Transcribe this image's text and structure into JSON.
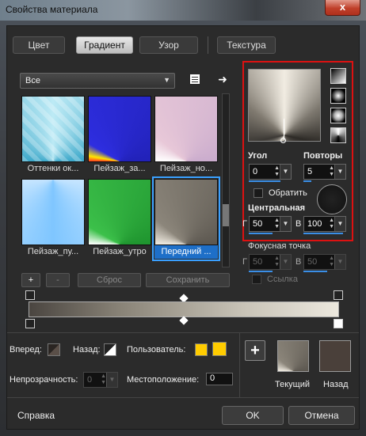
{
  "window": {
    "title": "Свойства материала",
    "close": "x"
  },
  "tabs": [
    {
      "label": "Цвет"
    },
    {
      "label": "Градиент"
    },
    {
      "label": "Узор"
    },
    {
      "label": "Текстура"
    }
  ],
  "filter": {
    "value": "Все"
  },
  "thumbnails": [
    {
      "label": "Оттенки ок..."
    },
    {
      "label": "Пейзаж_за..."
    },
    {
      "label": "Пейзаж_но..."
    },
    {
      "label": "Пейзаж_пу..."
    },
    {
      "label": "Пейзаж_утро"
    },
    {
      "label": "Передний ..."
    }
  ],
  "buttons": {
    "add": "+",
    "remove": "-",
    "reset": "Сброс",
    "save": "Сохранить"
  },
  "settings": {
    "angle_label": "Угол",
    "angle_value": "0",
    "repeats_label": "Повторы",
    "repeats_value": "5",
    "invert_label": "Обратить",
    "central_label": "Центральная",
    "central_g_label": "Г",
    "central_g_value": "50",
    "central_v_label": "В",
    "central_v_value": "100",
    "focal_label": "Фокусная точка",
    "focal_g_label": "Г",
    "focal_g_value": "50",
    "focal_v_label": "В",
    "focal_v_value": "50",
    "link_label": "Ссылка"
  },
  "bottom": {
    "forward_label": "Вперед:",
    "back_label": "Назад:",
    "user_label": "Пользователь:",
    "opacity_label": "Непрозрачность:",
    "opacity_value": "0",
    "location_label": "Местоположение:",
    "location_value": "0",
    "current_label": "Текущий",
    "back_swatch_label": "Назад",
    "add_swatch": "+"
  },
  "footer": {
    "help": "Справка",
    "ok": "OK",
    "cancel": "Отмена"
  },
  "colors": {
    "accent": "#3a8ee6",
    "highlight": "#d11111",
    "user": "#ffcc00",
    "back_swatch": "#4a403a"
  }
}
